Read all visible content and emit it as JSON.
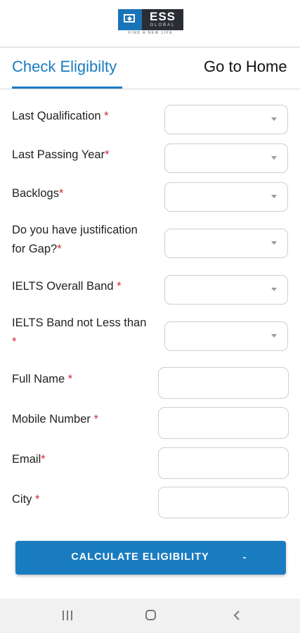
{
  "header": {
    "logo_word": "ESS",
    "logo_sub": "GLOBAL",
    "logo_tagline": "FIND A NEW LIFE"
  },
  "tabs": [
    {
      "label": "Check Eligibilty",
      "active": true
    },
    {
      "label": "Go to Home",
      "active": false
    }
  ],
  "form": {
    "required_mark": "*",
    "selects": [
      {
        "label": "Last Qualification ",
        "value": ""
      },
      {
        "label": "Last Passing Year",
        "value": ""
      },
      {
        "label": "Backlogs",
        "value": ""
      },
      {
        "label_line1": "Do you have justification",
        "label_line2": "for Gap?",
        "value": ""
      },
      {
        "label": "IELTS Overall Band ",
        "value": ""
      },
      {
        "label_line1": "IELTS Band not Less than",
        "label_line2": "",
        "value": ""
      }
    ],
    "inputs": [
      {
        "label": "Full Name ",
        "value": "",
        "placeholder": ""
      },
      {
        "label": "Mobile Number ",
        "value": "",
        "placeholder": ""
      },
      {
        "label": "Email",
        "value": "",
        "placeholder": ""
      },
      {
        "label": "City ",
        "value": "",
        "placeholder": ""
      }
    ]
  },
  "submit_button": {
    "label": "CALCULATE ELIGIBILITY"
  },
  "system_nav": {
    "icons": [
      "recent-apps-icon",
      "home-icon",
      "back-icon"
    ]
  },
  "colors": {
    "accent": "#1a7cc0",
    "required": "#d32b3a",
    "logo_blue": "#1a74b8",
    "logo_dark": "#2a2d33"
  }
}
